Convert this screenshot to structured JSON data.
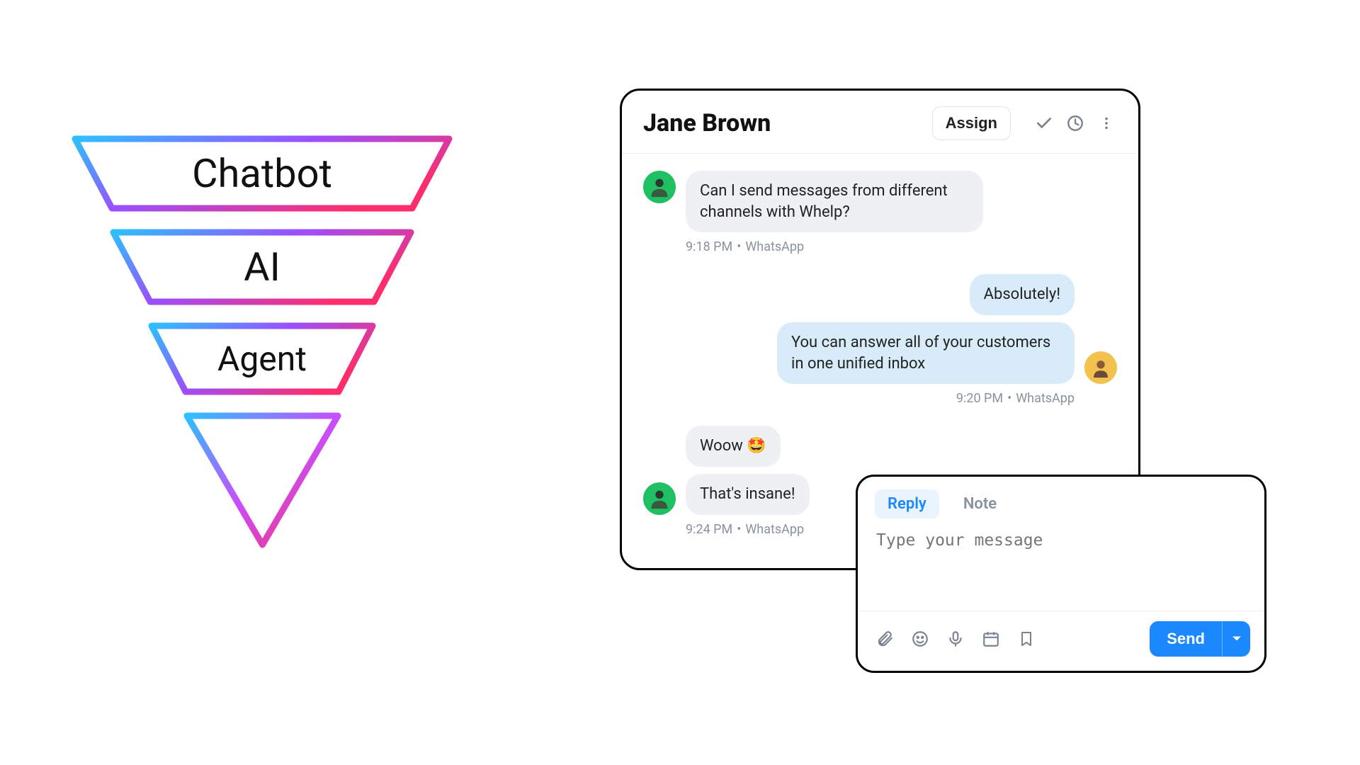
{
  "funnel": {
    "stages": [
      "Chatbot",
      "AI",
      "Agent"
    ],
    "logo_name": "whelp-logo"
  },
  "chat": {
    "header": {
      "title": "Jane Brown",
      "assign_label": "Assign"
    },
    "threads": [
      {
        "side": "left",
        "avatar": "green",
        "bubbles": [
          "Can I send messages from different channels with Whelp?"
        ],
        "meta_time": "9:18 PM",
        "meta_channel": "WhatsApp"
      },
      {
        "side": "right",
        "avatar": "yellow",
        "bubbles": [
          "Absolutely!",
          "You can answer all of your customers in one unified inbox"
        ],
        "meta_time": "9:20 PM",
        "meta_channel": "WhatsApp"
      },
      {
        "side": "left",
        "avatar": "green",
        "bubbles": [
          "Woow 🤩",
          "That's insane!"
        ],
        "meta_time": "9:24 PM",
        "meta_channel": "WhatsApp"
      }
    ]
  },
  "compose": {
    "tabs": {
      "reply": "Reply",
      "note": "Note"
    },
    "placeholder": "Type your message",
    "send_label": "Send"
  }
}
